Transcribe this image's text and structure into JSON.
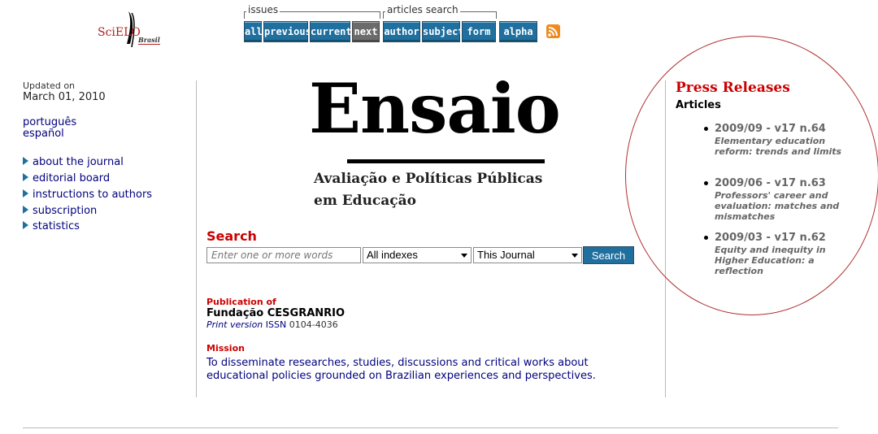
{
  "logo": {
    "text": "SciELO",
    "country": "Brasil"
  },
  "header": {
    "issues_label": "issues",
    "articles_search_label": "articles search",
    "issues_buttons": [
      {
        "label": "all",
        "enabled": true
      },
      {
        "label": "previous",
        "enabled": true
      },
      {
        "label": "current",
        "enabled": true
      },
      {
        "label": "next",
        "enabled": false
      }
    ],
    "search_buttons": [
      {
        "label": "author"
      },
      {
        "label": "subject"
      },
      {
        "label": "form"
      }
    ],
    "alpha_label": "alpha",
    "rss_icon": "rss-feed-icon"
  },
  "sidebar": {
    "updated_label": "Updated on",
    "updated_date": "March 01, 2010",
    "languages": [
      "português",
      "español"
    ],
    "links": [
      "about the journal",
      "editorial board",
      "instructions to authors",
      "subscription",
      "statistics"
    ]
  },
  "masthead": {
    "title": "Ensaio",
    "subtitle_line1": "Avaliação e Políticas Públicas",
    "subtitle_line2": "em Educação"
  },
  "search": {
    "heading": "Search",
    "placeholder": "Enter one or more words",
    "index_select": "All indexes",
    "scope_select": "This Journal",
    "button_label": "Search"
  },
  "publication": {
    "heading": "Publication of",
    "publisher": "Fundação CESGRANRIO",
    "print_version_label": "Print version",
    "issn_label": "ISSN",
    "issn": "0104-4036"
  },
  "mission": {
    "heading": "Mission",
    "line1": "To disseminate researches, studies, discussions and critical works about",
    "line2": "educational policies grounded on Brazilian experiences and perspectives."
  },
  "press_releases": {
    "heading": "Press Releases",
    "subheading": "Articles",
    "items": [
      {
        "date": "2009/09 - v17 n.64",
        "title": "Elementary education reform: trends and limits"
      },
      {
        "date": "2009/06 - v17 n.63",
        "title": "Professors' career and evaluation: matches and mismatches"
      },
      {
        "date": "2009/03 - v17 n.62",
        "title": "Equity and inequity in Higher Education: a reflection"
      }
    ]
  },
  "colors": {
    "accent": "#1f6f9f",
    "heading_red": "#cc0000",
    "link": "#000080"
  }
}
